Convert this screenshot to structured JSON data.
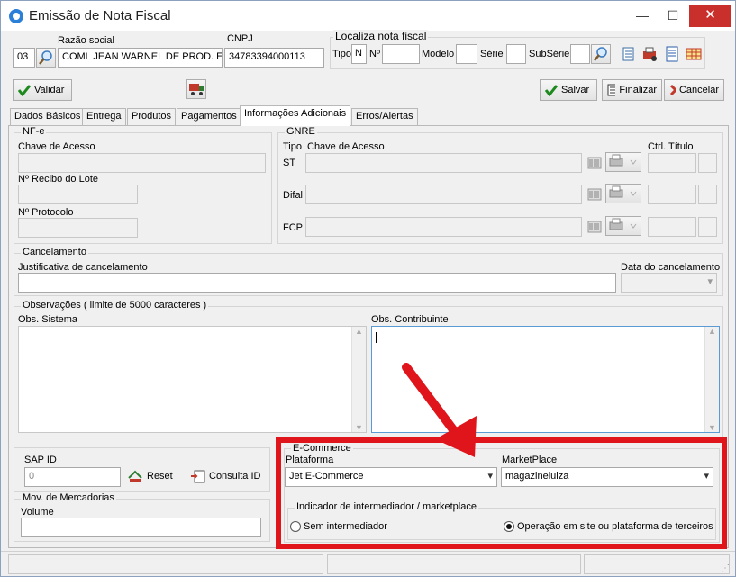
{
  "window": {
    "title": "Emissão de Nota Fiscal",
    "minimize": "—",
    "maximize": "☐",
    "close": "✕"
  },
  "header": {
    "razao_social_label": "Razão social",
    "cnpj_label": "CNPJ",
    "code_value": "03",
    "razao_social_value": "COML JEAN WARNEL DE PROD. ESP.",
    "cnpj_value": "34783394000113",
    "localiza_title": "Localiza nota fiscal",
    "tipo_label": "Tipo",
    "tipo_value": "N",
    "numero_label": "Nº",
    "modelo_label": "Modelo",
    "serie_label": "Série",
    "subserie_label": "SubSérie"
  },
  "toolbar": {
    "validar": "Validar",
    "salvar": "Salvar",
    "finalizar": "Finalizar",
    "cancelar": "Cancelar"
  },
  "tabs": [
    "Dados Básicos",
    "Entrega",
    "Produtos",
    "Pagamentos",
    "Informações Adicionais",
    "Erros/Alertas"
  ],
  "nfe": {
    "title": "NF-e",
    "chave_label": "Chave de Acesso",
    "recibo_label": "Nº Recibo do Lote",
    "protocolo_label": "Nº Protocolo"
  },
  "gnre": {
    "title": "GNRE",
    "tipo_label": "Tipo",
    "chave_label": "Chave de Acesso",
    "ctrl_label": "Ctrl. Título",
    "rows": [
      "ST",
      "Difal",
      "FCP"
    ]
  },
  "cancelamento": {
    "title": "Cancelamento",
    "justificativa_label": "Justificativa de cancelamento",
    "data_label": "Data do cancelamento"
  },
  "observacoes": {
    "title": "Observações ( limite de 5000 caracteres )",
    "sistema_label": "Obs. Sistema",
    "contribuinte_label": "Obs. Contribuinte"
  },
  "sap": {
    "label": "SAP ID",
    "value": "0",
    "reset": "Reset",
    "consulta": "Consulta ID"
  },
  "mov": {
    "title": "Mov. de Mercadorias",
    "volume_label": "Volume"
  },
  "ecommerce": {
    "title": "E-Commerce",
    "plataforma_label": "Plataforma",
    "plataforma_value": "Jet E-Commerce",
    "marketplace_label": "MarketPlace",
    "marketplace_value": "magazineluiza",
    "indicador_title": "Indicador de intermediador / marketplace",
    "opt_sem": "Sem intermediador",
    "opt_terceiros": "Operação em site ou plataforma de terceiros",
    "selected": "terceiros",
    "highlight_color": "#e0141b"
  }
}
